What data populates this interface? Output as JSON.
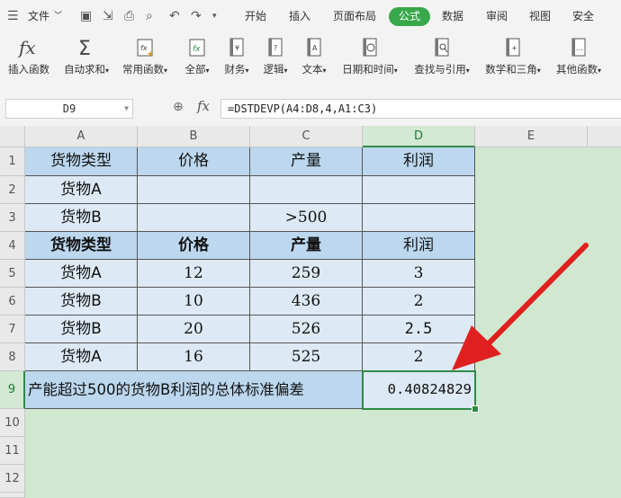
{
  "menubar": {
    "file_label": "文件",
    "tabs": [
      "开始",
      "插入",
      "页面布局",
      "公式",
      "数据",
      "审阅",
      "视图",
      "安全"
    ],
    "active_tab": "公式"
  },
  "ribbon": {
    "buttons": [
      {
        "label": "插入函数",
        "icon": "fx-icon"
      },
      {
        "label": "自动求和",
        "icon": "sigma-icon"
      },
      {
        "label": "常用函数",
        "icon": "star-function-icon"
      },
      {
        "label": "全部",
        "icon": "all-functions-icon"
      },
      {
        "label": "财务",
        "icon": "finance-book-icon"
      },
      {
        "label": "逻辑",
        "icon": "logic-book-icon"
      },
      {
        "label": "文本",
        "icon": "text-book-icon"
      },
      {
        "label": "日期和时间",
        "icon": "clock-book-icon"
      },
      {
        "label": "查找与引用",
        "icon": "lookup-book-icon"
      },
      {
        "label": "数学和三角",
        "icon": "math-book-icon"
      },
      {
        "label": "其他函数",
        "icon": "more-functions-icon"
      }
    ]
  },
  "formula_bar": {
    "name_box": "D9",
    "fx_label": "fx",
    "formula": "=DSTDEVP(A4:D8,4,A1:C3)"
  },
  "grid": {
    "columns": [
      "A",
      "B",
      "C",
      "D",
      "E"
    ],
    "rows": [
      "1",
      "2",
      "3",
      "4",
      "5",
      "6",
      "7",
      "8",
      "9",
      "10",
      "11",
      "12"
    ],
    "selected_column": "D",
    "selected_row": "9",
    "criteria_header": [
      "货物类型",
      "价格",
      "产量",
      "利润"
    ],
    "criteria_rows": [
      [
        "货物A",
        "",
        "",
        ""
      ],
      [
        "货物B",
        "",
        ">500",
        ""
      ]
    ],
    "data_header": [
      "货物类型",
      "价格",
      "产量",
      "利润"
    ],
    "data_rows": [
      [
        "货物A",
        "12",
        "259",
        "3"
      ],
      [
        "货物B",
        "10",
        "436",
        "2"
      ],
      [
        "货物B",
        "20",
        "526",
        "2.5"
      ],
      [
        "货物A",
        "16",
        "525",
        "2"
      ]
    ],
    "result_label": "产能超过500的货物B利润的总体标准偏差",
    "result_value": "0.40824829"
  },
  "colors": {
    "accent_green": "#39a84b",
    "sheet_background": "#cfe8cf",
    "header_fill": "#bcd7ee",
    "label_fill": "#dde9f4",
    "arrow_red": "#e02020"
  }
}
